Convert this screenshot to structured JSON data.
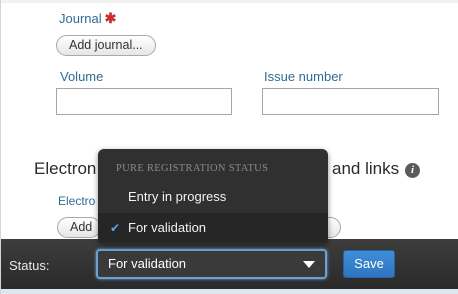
{
  "form": {
    "journal_label": "Journal",
    "required_marker": "✱",
    "add_journal_label": "Add journal...",
    "volume_label": "Volume",
    "volume_value": "",
    "issue_number_label": "Issue number",
    "issue_number_value": "",
    "electronic_section_left": "Electron",
    "electronic_section_right": "and links",
    "electronic_sub_label": "Electro",
    "add_sub_button_label": "Add"
  },
  "dropdown": {
    "header": "PURE REGISTRATION STATUS",
    "options": [
      {
        "label": "Entry in progress",
        "selected": false
      },
      {
        "label": "For validation",
        "selected": true
      }
    ]
  },
  "statusbar": {
    "status_label": "Status:",
    "selected_value": "For validation",
    "save_label": "Save"
  },
  "colors": {
    "label_blue": "#2f6d93",
    "required_red": "#c9302c",
    "statusbar_bg": "#2a2a2a",
    "accent_blue": "#3f8fd8"
  },
  "icons": {
    "required": "asterisk-icon",
    "info": "info-icon",
    "caret": "caret-down-icon",
    "check": "check-icon"
  }
}
